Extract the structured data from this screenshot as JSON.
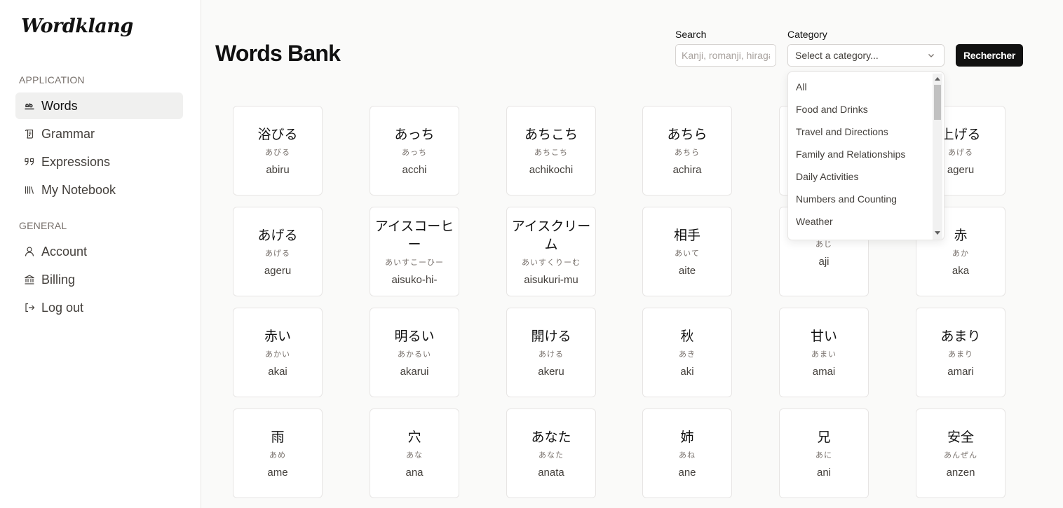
{
  "app": {
    "logo": "Wordklang"
  },
  "sidebar": {
    "sections": [
      {
        "label": "APPLICATION",
        "items": [
          {
            "label": "Words",
            "icon": "text-ab-icon",
            "active": true
          },
          {
            "label": "Grammar",
            "icon": "scroll-icon",
            "active": false
          },
          {
            "label": "Expressions",
            "icon": "quote-icon",
            "active": false
          },
          {
            "label": "My Notebook",
            "icon": "library-icon",
            "active": false
          }
        ]
      },
      {
        "label": "GENERAL",
        "items": [
          {
            "label": "Account",
            "icon": "user-icon",
            "active": false
          },
          {
            "label": "Billing",
            "icon": "bank-icon",
            "active": false
          },
          {
            "label": "Log out",
            "icon": "logout-icon",
            "active": false
          }
        ]
      }
    ]
  },
  "main": {
    "title": "Words Bank",
    "search": {
      "label": "Search",
      "placeholder": "Kanji, romanji, hiragana",
      "value": ""
    },
    "category": {
      "label": "Category",
      "placeholder": "Select a category...",
      "options": [
        "All",
        "Food and Drinks",
        "Travel and Directions",
        "Family and Relationships",
        "Daily Activities",
        "Numbers and Counting",
        "Weather"
      ]
    },
    "submit_label": "Rechercher",
    "words": [
      {
        "kanji": "浴びる",
        "kana": "あびる",
        "romaji": "abiru"
      },
      {
        "kanji": "あっち",
        "kana": "あっち",
        "romaji": "acchi"
      },
      {
        "kanji": "あちこち",
        "kana": "あちこち",
        "romaji": "achikochi"
      },
      {
        "kanji": "あちら",
        "kana": "あちら",
        "romaji": "achira"
      },
      {
        "kanji": "",
        "kana": "",
        "romaji": ""
      },
      {
        "kanji": "上げる",
        "kana": "あげる",
        "romaji": "ageru"
      },
      {
        "kanji": "あげる",
        "kana": "あげる",
        "romaji": "ageru"
      },
      {
        "kanji": "アイスコーヒー",
        "kana": "あいすこーひー",
        "romaji": "aisuko-hi-"
      },
      {
        "kanji": "アイスクリーム",
        "kana": "あいすくりーむ",
        "romaji": "aisukuri-mu"
      },
      {
        "kanji": "相手",
        "kana": "あいて",
        "romaji": "aite"
      },
      {
        "kanji": "",
        "kana": "あじ",
        "romaji": "aji"
      },
      {
        "kanji": "赤",
        "kana": "あか",
        "romaji": "aka"
      },
      {
        "kanji": "赤い",
        "kana": "あかい",
        "romaji": "akai"
      },
      {
        "kanji": "明るい",
        "kana": "あかるい",
        "romaji": "akarui"
      },
      {
        "kanji": "開ける",
        "kana": "あける",
        "romaji": "akeru"
      },
      {
        "kanji": "秋",
        "kana": "あき",
        "romaji": "aki"
      },
      {
        "kanji": "甘い",
        "kana": "あまい",
        "romaji": "amai"
      },
      {
        "kanji": "あまり",
        "kana": "あまり",
        "romaji": "amari"
      },
      {
        "kanji": "雨",
        "kana": "あめ",
        "romaji": "ame"
      },
      {
        "kanji": "穴",
        "kana": "あな",
        "romaji": "ana"
      },
      {
        "kanji": "あなた",
        "kana": "あなた",
        "romaji": "anata"
      },
      {
        "kanji": "姉",
        "kana": "あね",
        "romaji": "ane"
      },
      {
        "kanji": "兄",
        "kana": "あに",
        "romaji": "ani"
      },
      {
        "kanji": "安全",
        "kana": "あんぜん",
        "romaji": "anzen"
      }
    ]
  }
}
